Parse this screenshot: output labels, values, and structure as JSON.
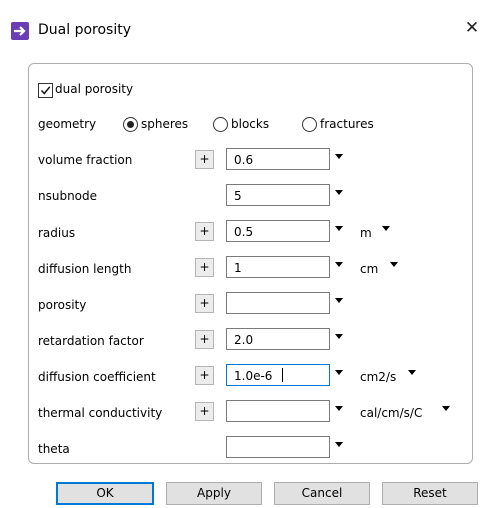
{
  "window": {
    "title": "Dual porosity",
    "close_glyph": "✕",
    "icon": "arrow-right-icon",
    "accent": "#6a3fb5"
  },
  "dual_porosity": {
    "label": "dual porosity",
    "checked": true
  },
  "geometry": {
    "label": "geometry",
    "options": [
      "spheres",
      "blocks",
      "fractures"
    ],
    "selected": "spheres"
  },
  "fields": [
    {
      "label": "volume fraction",
      "value": "0.6",
      "plus": "+",
      "unit": ""
    },
    {
      "label": "nsubnode",
      "value": "5",
      "plus": "",
      "unit": ""
    },
    {
      "label": "radius",
      "value": "0.5",
      "plus": "+",
      "unit": "m"
    },
    {
      "label": "diffusion length",
      "value": "1",
      "plus": "+",
      "unit": "cm"
    },
    {
      "label": "porosity",
      "value": "",
      "plus": "+",
      "unit": ""
    },
    {
      "label": "retardation factor",
      "value": "2.0",
      "plus": "+",
      "unit": ""
    },
    {
      "label": "diffusion coefficient",
      "value": "1.0e-6",
      "plus": "+",
      "unit": "cm2/s"
    },
    {
      "label": "thermal conductivity",
      "value": "",
      "plus": "+",
      "unit": "cal/cm/s/C"
    },
    {
      "label": "theta",
      "value": "",
      "plus": "",
      "unit": ""
    }
  ],
  "buttons": {
    "ok": "OK",
    "apply": "Apply",
    "cancel": "Cancel",
    "reset": "Reset"
  }
}
